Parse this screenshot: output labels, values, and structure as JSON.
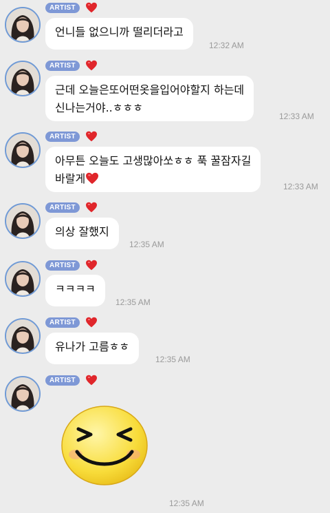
{
  "colors": {
    "background": "#ececec",
    "bubble": "#ffffff",
    "badge": "#7e98d6",
    "avatar_ring": "#6f9ad6",
    "heart": "#e0262b",
    "timestamp": "#9a9a9a"
  },
  "badge_label": "ARTIST",
  "icons": {
    "avatar": "profile-photo",
    "badge_heart": "red-heart",
    "inline_heart": "red-heart",
    "sticker": "laughing-face-emoticon"
  },
  "messages": [
    {
      "lines": [
        "언니들 없으니까 떨리더라고"
      ],
      "time": "12:32 AM"
    },
    {
      "lines": [
        "근데 오늘은또어떤옷을입어야할지 하는데",
        "신나는거야..ㅎㅎㅎ"
      ],
      "time": "12:33 AM"
    },
    {
      "lines": [
        "아무튼 오늘도 고생많아쏘ㅎㅎ 푹 꿀잠자길",
        "바랄게"
      ],
      "time": "12:33 AM"
    },
    {
      "lines": [
        "의상 잘했지"
      ],
      "time": "12:35 AM"
    },
    {
      "lines": [
        "ㅋㅋㅋㅋ"
      ],
      "time": "12:35 AM"
    },
    {
      "lines": [
        "유나가 고름ㅎㅎ"
      ],
      "time": "12:35 AM"
    },
    {
      "lines": [],
      "time": "12:35 AM",
      "sticker": "laughing-face-emoticon"
    }
  ]
}
